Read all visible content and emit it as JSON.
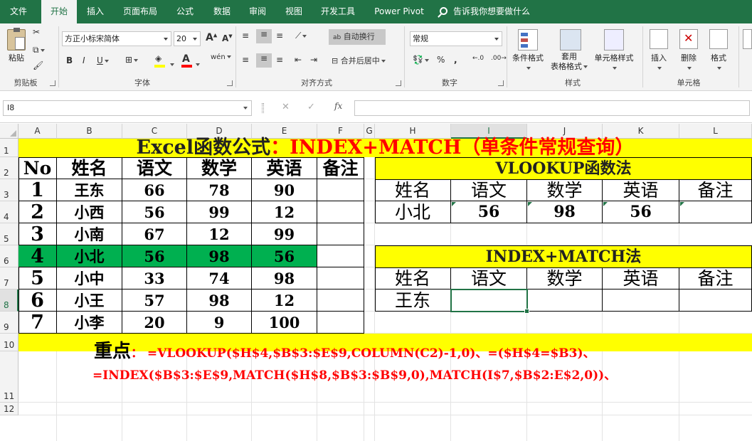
{
  "ribbon_tabs": [
    "文件",
    "开始",
    "插入",
    "页面布局",
    "公式",
    "数据",
    "审阅",
    "视图",
    "开发工具",
    "Power Pivot"
  ],
  "tell_me": "告诉我你想要做什么",
  "ribbon": {
    "paste": "粘贴",
    "clipboard": "剪贴板",
    "font_name": "方正小标宋简体",
    "font_size": "20",
    "font_group": "字体",
    "wrap_text": "自动换行",
    "merge_center": "合并后居中",
    "align_group": "对齐方式",
    "number_format": "常规",
    "number_group": "数字",
    "cond_format": "条件格式",
    "table_format_1": "套用",
    "table_format_2": "表格格式",
    "cell_style": "单元格样式",
    "style_group": "样式",
    "insert": "插入",
    "delete": "删除",
    "format": "格式",
    "cells_group": "单元格",
    "bold": "B",
    "italic": "I",
    "underline": "U",
    "font_color_letter": "A",
    "grow_font": "A",
    "shrink_font": "A",
    "percent": "%",
    "comma": ",",
    "phonetic": "wén",
    "wrap_glyph": "ab"
  },
  "formula_bar": {
    "name_box": "I8",
    "fx": "fx",
    "content": ""
  },
  "columns": [
    "A",
    "B",
    "C",
    "D",
    "E",
    "F",
    "G",
    "H",
    "I",
    "J",
    "K",
    "L"
  ],
  "rows": [
    "1",
    "2",
    "3",
    "4",
    "5",
    "6",
    "7",
    "8",
    "9",
    "10",
    "11",
    "12"
  ],
  "title": {
    "black": "Excel函数公式",
    "red": "：INDEX+MATCH（单条件常规查询）"
  },
  "main_table": {
    "headers": [
      "No",
      "姓名",
      "语文",
      "数学",
      "英语",
      "备注"
    ],
    "rows": [
      [
        "1",
        "王东",
        "66",
        "78",
        "90",
        ""
      ],
      [
        "2",
        "小西",
        "56",
        "99",
        "12",
        ""
      ],
      [
        "3",
        "小南",
        "67",
        "12",
        "99",
        ""
      ],
      [
        "4",
        "小北",
        "56",
        "98",
        "56",
        ""
      ],
      [
        "5",
        "小中",
        "33",
        "74",
        "98",
        ""
      ],
      [
        "6",
        "小王",
        "57",
        "98",
        "12",
        ""
      ],
      [
        "7",
        "小李",
        "20",
        "9",
        "100",
        ""
      ]
    ]
  },
  "vlookup_section": {
    "title": "VLOOKUP函数法",
    "headers": [
      "姓名",
      "语文",
      "数学",
      "英语",
      "备注"
    ],
    "values": [
      "小北",
      "56",
      "98",
      "56",
      ""
    ]
  },
  "index_section": {
    "title": "INDEX+MATCH法",
    "headers": [
      "姓名",
      "语文",
      "数学",
      "英语",
      "备注"
    ],
    "values": [
      "王东",
      "",
      "",
      "",
      ""
    ]
  },
  "notes": {
    "label": "重点",
    "line1": "：  =VLOOKUP($H$4,$B$3:$E$9,COLUMN(C2)-1,0)、=($H$4=$B3)、",
    "line2": "=INDEX($B$3:$E$9,MATCH($H$8,$B$3:$B$9,0),MATCH(I$7,$B$2:E$2,0))、"
  },
  "colors": {
    "excel_green": "#217346",
    "highlight_row": "#00b050",
    "band": "#ffff00",
    "red": "#ff0000"
  }
}
